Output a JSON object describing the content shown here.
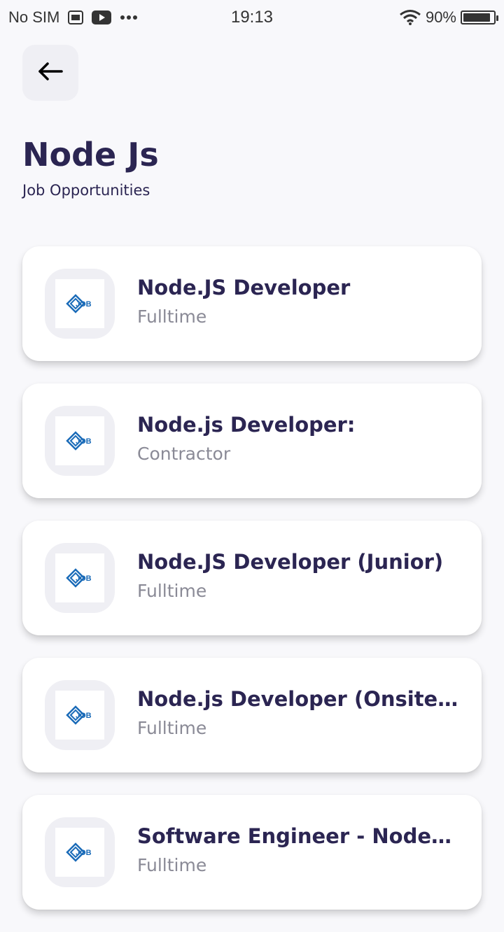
{
  "status_bar": {
    "carrier": "No SIM",
    "time": "19:13",
    "battery_percent": "90%",
    "battery_level": 0.9,
    "icons": [
      "message-icon",
      "youtube-icon",
      "more-dots-icon",
      "wifi-icon",
      "battery-icon"
    ]
  },
  "header": {
    "back_icon": "arrow-left-icon",
    "title": "Node Js",
    "subtitle": "Job Opportunities"
  },
  "jobs": [
    {
      "title": "Node.JS Developer",
      "type": "Fulltime",
      "logo_text": "JOB"
    },
    {
      "title": "Node.js Developer:",
      "type": "Contractor",
      "logo_text": "JOB"
    },
    {
      "title": "Node.JS Developer (Junior)",
      "type": "Fulltime",
      "logo_text": "JOB"
    },
    {
      "title": "Node.js Developer (Onsite…",
      "type": "Fulltime",
      "logo_text": "JOB"
    },
    {
      "title": "Software Engineer - Node.…",
      "type": "Fulltime",
      "logo_text": "JOB"
    }
  ],
  "colors": {
    "background": "#f8f8fb",
    "primary_text": "#2b2552",
    "secondary_text": "#8a8a96",
    "logo_blue": "#1a6bb8"
  }
}
